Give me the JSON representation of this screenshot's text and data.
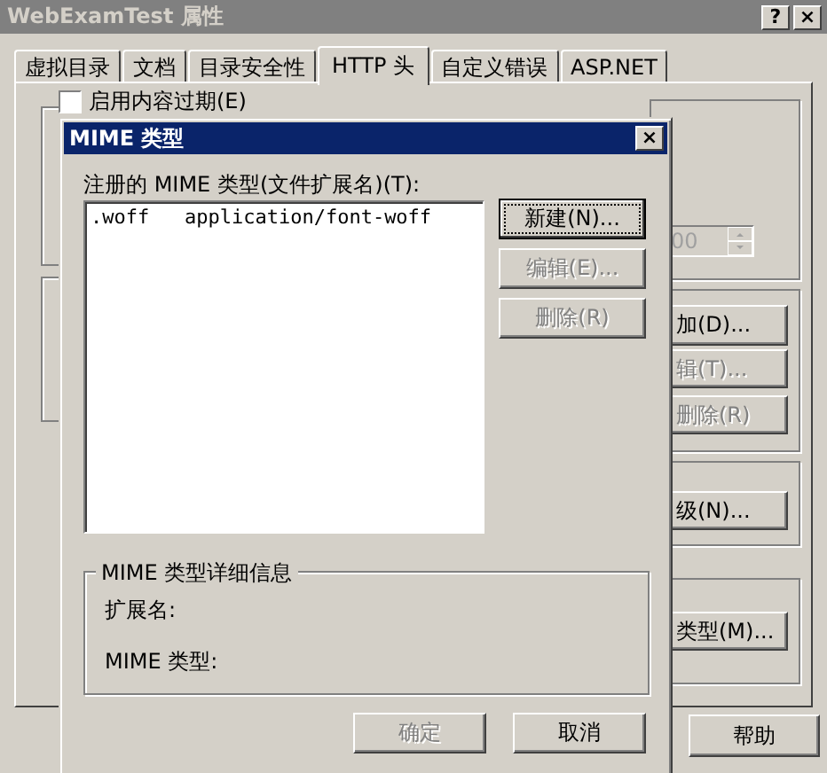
{
  "window": {
    "title": "WebExamTest 属性",
    "buttons": [
      "?",
      "×"
    ]
  },
  "tabs": [
    {
      "label": "虚拟目录",
      "selected": false
    },
    {
      "label": "文档",
      "selected": false
    },
    {
      "label": "目录安全性",
      "selected": false
    },
    {
      "label": "HTTP 头",
      "selected": true
    },
    {
      "label": "自定义错误",
      "selected": false
    },
    {
      "label": "ASP.NET",
      "selected": false
    }
  ],
  "content_expiry": {
    "label": "启用内容过期(E)",
    "checked": false
  },
  "spinner": {
    "value": "00"
  },
  "background_buttons": [
    {
      "label": "加(D)...",
      "disabled": false
    },
    {
      "label": "辑(T)...",
      "disabled": true
    },
    {
      "label": "删除(R)",
      "disabled": true
    },
    {
      "label": "级(N)...",
      "disabled": false
    },
    {
      "label": "类型(M)...",
      "disabled": false
    }
  ],
  "help_button": {
    "label": "帮助"
  },
  "mime_dialog": {
    "title": "MIME 类型",
    "close": "×",
    "list_label": "注册的 MIME 类型(文件扩展名)(T):",
    "entries": [
      {
        "extension": ".woff",
        "type": "application/font-woff",
        "selected": false
      }
    ],
    "side_buttons": [
      {
        "label": "新建(N)...",
        "disabled": false,
        "focused": true
      },
      {
        "label": "编辑(E)...",
        "disabled": true,
        "focused": false
      },
      {
        "label": "删除(R)",
        "disabled": true,
        "focused": false
      }
    ],
    "details": {
      "title": "MIME 类型详细信息",
      "extension_label": "扩展名:",
      "type_label": "MIME 类型:"
    },
    "buttons": [
      {
        "label": "确定",
        "disabled": true
      },
      {
        "label": "取消",
        "disabled": false
      }
    ]
  }
}
